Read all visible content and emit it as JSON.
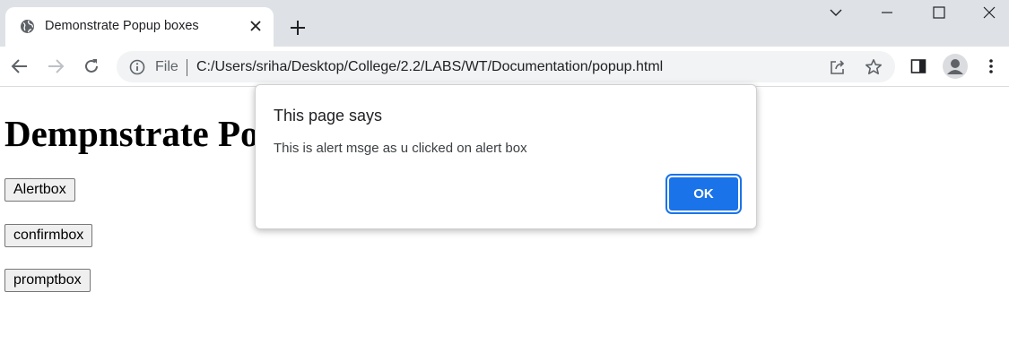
{
  "browser": {
    "tab": {
      "title": "Demonstrate Popup boxes",
      "favicon": "globe-icon"
    },
    "address_bar": {
      "scheme_label": "File",
      "url": "C:/Users/sriha/Desktop/College/2.2/LABS/WT/Documentation/popup.html"
    }
  },
  "page": {
    "heading": "Dempnstrate Popup boxes",
    "buttons": [
      "Alertbox",
      "confirmbox",
      "promptbox"
    ]
  },
  "dialog": {
    "title": "This page says",
    "message": "This is alert msge as u clicked on alert box",
    "ok_label": "OK"
  },
  "colors": {
    "tabstrip_bg": "#dee1e6",
    "omnibox_bg": "#f1f3f4",
    "accent_blue": "#1a73e8",
    "icon_gray": "#5f6368"
  }
}
